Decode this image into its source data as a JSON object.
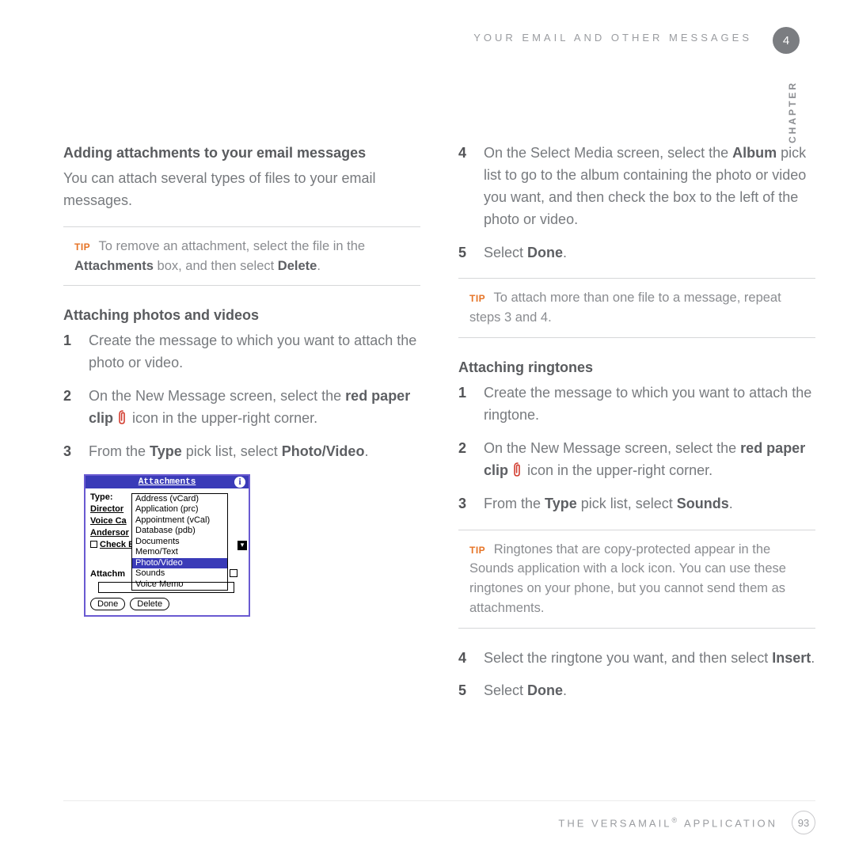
{
  "header": {
    "running_head": "YOUR EMAIL AND OTHER MESSAGES",
    "chapter_number": "4",
    "chapter_label": "CHAPTER"
  },
  "left": {
    "section1_title": "Adding attachments to your email messages",
    "section1_body": "You can attach several types of files to your email messages.",
    "tip1_a": "To remove an attachment, select the file in the ",
    "tip1_b_bold": "Attachments",
    "tip1_c": " box, and then select ",
    "tip1_d_bold": "Delete",
    "tip1_e": ".",
    "section2_title": "Attaching photos and videos",
    "steps": {
      "s1": "Create the message to which you want to attach the photo or video.",
      "s2_a": "On the New Message screen, select the ",
      "s2_b_bold": "red paper clip ",
      "s2_c": " icon in the upper-right corner.",
      "s3_a": "From the ",
      "s3_b_bold": "Type",
      "s3_c": " pick list, select ",
      "s3_d_bold": "Photo/Video",
      "s3_e": "."
    },
    "shot": {
      "title": "Attachments",
      "left_labels": [
        "Type:",
        "Director",
        "Voice Ca",
        "Andersor",
        "Check Bill"
      ],
      "attach_label": "Attachm",
      "type_options": [
        "Address (vCard)",
        "Application (prc)",
        "Appointment (vCal)",
        "Database (pdb)",
        "Documents",
        "Memo/Text",
        "Photo/Video",
        "Sounds",
        "Voice Memo"
      ],
      "btn_done": "Done",
      "btn_delete": "Delete"
    }
  },
  "right": {
    "steps_a": {
      "s4_a": "On the Select Media screen, select the ",
      "s4_b_bold": "Album",
      "s4_c": " pick list to go to the album containing the photo or video you want, and then check the box to the left of the photo or video.",
      "s5_a": "Select ",
      "s5_b_bold": "Done",
      "s5_c": "."
    },
    "tip2": "To attach more than one file to a message, repeat steps 3 and 4.",
    "section3_title": "Attaching ringtones",
    "steps_b": {
      "s1": "Create the message to which you want to attach the ringtone.",
      "s2_a": "On the New Message screen, select the ",
      "s2_b_bold": "red paper clip ",
      "s2_c": " icon in the upper-right corner.",
      "s3_a": "From the ",
      "s3_b_bold": "Type",
      "s3_c": " pick list, select ",
      "s3_d_bold": "Sounds",
      "s3_e": "."
    },
    "tip3": "Ringtones that are copy-protected appear in the Sounds application with a lock icon. You can use these ringtones on your phone, but you cannot send them as attachments.",
    "steps_c": {
      "s4_a": "Select the ringtone you want, and then select ",
      "s4_b_bold": "Insert",
      "s4_c": ".",
      "s5_a": "Select ",
      "s5_b_bold": "Done",
      "s5_c": "."
    }
  },
  "footer": {
    "app_name_a": "THE VERSAMAIL",
    "app_name_b": " APPLICATION",
    "page": "93"
  },
  "labels": {
    "tip": "TIP"
  }
}
